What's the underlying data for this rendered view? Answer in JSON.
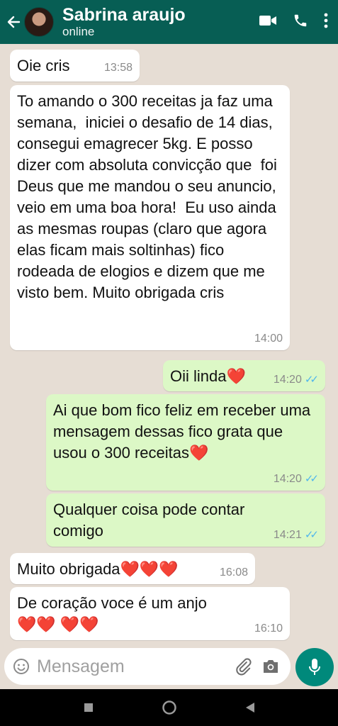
{
  "header": {
    "contact_name": "Sabrina araujo",
    "status": "online"
  },
  "messages": [
    {
      "dir": "in",
      "text": "Oie cris",
      "time": "13:58"
    },
    {
      "dir": "in",
      "text": "To amando o 300 receitas ja faz uma semana,  iniciei o desafio de 14 dias, consegui emagrecer 5kg. E posso dizer com absoluta convicção que  foi Deus que me mandou o seu anuncio, veio em uma boa hora!  Eu uso ainda as mesmas roupas (claro que agora elas ficam mais soltinhas) fico rodeada de elogios e dizem que me visto bem. Muito obrigada cris",
      "time": "14:00"
    },
    {
      "dir": "out",
      "text": "Oii linda❤️",
      "time": "14:20"
    },
    {
      "dir": "out",
      "text": "Ai que bom fico feliz em receber uma mensagem dessas fico grata que usou o 300 receitas❤️",
      "time": "14:20"
    },
    {
      "dir": "out",
      "text": "Qualquer coisa pode contar comigo",
      "time": "14:21"
    },
    {
      "dir": "in",
      "text": "Muito obrigada❤️❤️❤️",
      "time": "16:08"
    },
    {
      "dir": "in",
      "text": "De coração voce é um anjo ❤️❤️ ❤️❤️",
      "time": "16:10"
    }
  ],
  "composer": {
    "placeholder": "Mensagem"
  },
  "icons": {
    "back": "arrow-back-icon",
    "video": "video-call-icon",
    "call": "phone-icon",
    "menu": "more-vert-icon",
    "emoji": "emoji-icon",
    "attach": "paperclip-icon",
    "camera": "camera-icon",
    "mic": "mic-icon",
    "read": "double-check-icon"
  },
  "colors": {
    "header": "#075e54",
    "incoming": "#ffffff",
    "outgoing": "#dcf8c6",
    "read_ticks": "#4fb6ec",
    "mic_button": "#00897b"
  }
}
